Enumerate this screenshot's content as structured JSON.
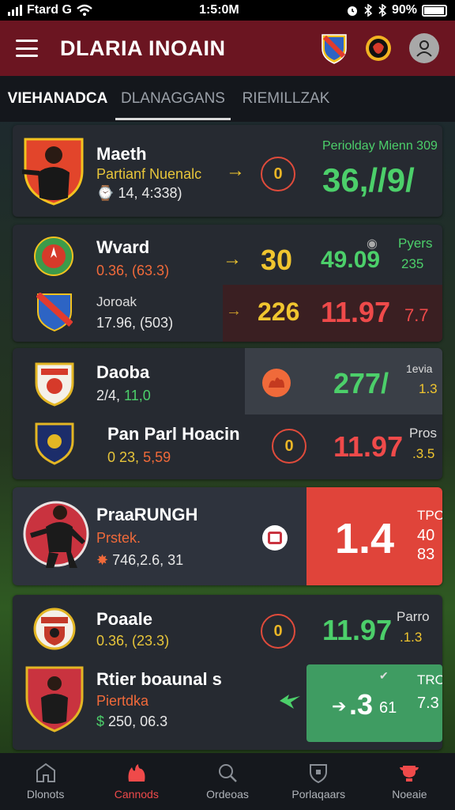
{
  "status_bar": {
    "carrier": "Ftard G",
    "time": "1:5:0M",
    "battery": "90%"
  },
  "app_bar": {
    "title": "DLARIA INOAIN"
  },
  "tabs": [
    {
      "label": "VIEHANADCA"
    },
    {
      "label": "DLANAGGANS"
    },
    {
      "label": "RIEMILLZAK"
    }
  ],
  "matches": {
    "m1": {
      "name": "Maeth",
      "sub": "Partianf Nuenalc",
      "time": "14, 4:338)",
      "score_badge": "0",
      "header": "Periolday Mienn 309",
      "big": "36,//9/"
    },
    "m2": {
      "team1": {
        "name": "Wvard",
        "sub": "0.36, (63.3)",
        "big_left": "30",
        "big_right": "49.09",
        "small_top": "Pyers",
        "small_bottom": "235"
      },
      "team2": {
        "name": "Joroak",
        "sub": "17.96, (503)",
        "big_left": "226",
        "big_right": "11.97",
        "small": "7.7"
      }
    },
    "m3": {
      "team1": {
        "name": "Daoba",
        "sub_a": "2/4,",
        "sub_b": "11,0",
        "big": "277/",
        "small_top": "1evia",
        "small_bottom": "1.3"
      },
      "team2": {
        "name": "Pan Parl Hoacin",
        "sub_a": "0 23,",
        "sub_b": "5,59",
        "score_badge": "0",
        "big": "11.97",
        "small_top": "Pros",
        "small_bottom": ".3.5"
      }
    },
    "m4": {
      "name": "PraaRUNGH",
      "sub": "Prstek.",
      "detail": "746,2.6, 31",
      "big": "1.4",
      "small_top": "TPO",
      "small_mid": "40",
      "small_bottom": "83"
    },
    "m5": {
      "team1": {
        "name": "Poaale",
        "sub": "0.36, (23.3)",
        "score_badge": "0",
        "big": "11.97",
        "small_top": "Parro",
        "small_bottom": ".1.3"
      },
      "team2": {
        "name": "Rtier boaunal s",
        "sub": "Piertdka",
        "detail": "250, 06.3",
        "big": ".3",
        "big_suffix": "61",
        "small_top": "TRO",
        "small_bottom": "7.3"
      }
    }
  },
  "bottom_nav": [
    {
      "label": "Dlonots",
      "icon": "home-icon"
    },
    {
      "label": "Cannods",
      "icon": "fire-icon"
    },
    {
      "label": "Ordeoas",
      "icon": "search-icon"
    },
    {
      "label": "Porlaqaars",
      "icon": "shield-icon"
    },
    {
      "label": "Noeaie",
      "icon": "trophy-icon"
    }
  ],
  "colors": {
    "app_bar": "#6b1521",
    "accent_red": "#e0443a",
    "accent_green": "#3f9c62",
    "yellow": "#f0c52f",
    "green_text": "#4ccf6a"
  }
}
